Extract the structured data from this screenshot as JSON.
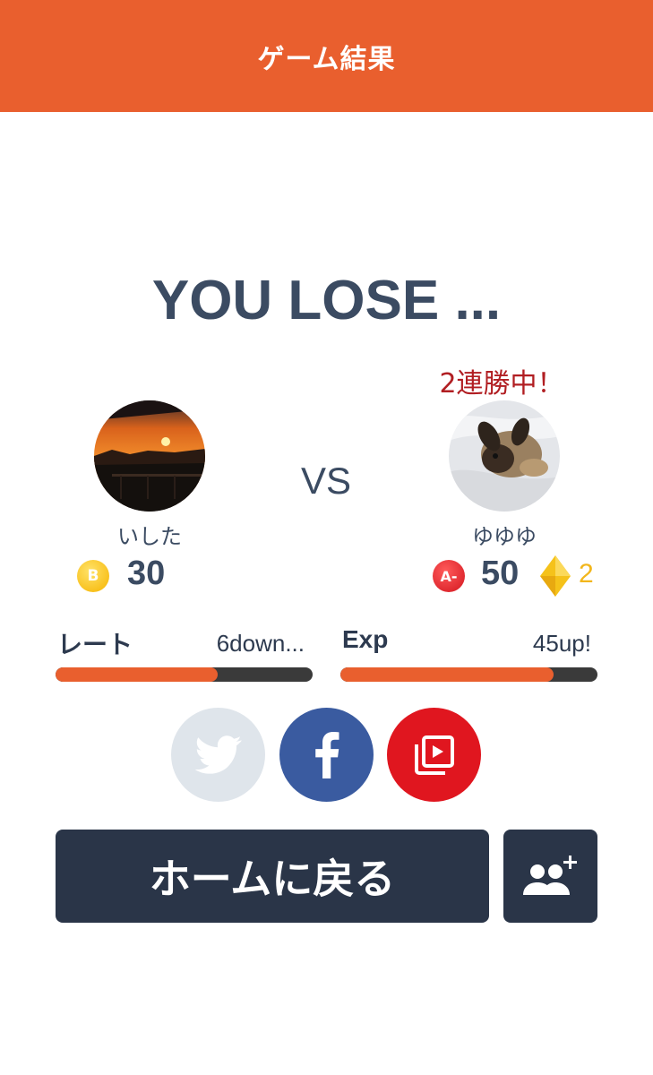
{
  "header": {
    "title": "ゲーム結果"
  },
  "result": {
    "text": "YOU LOSE ..."
  },
  "opponent_streak": "2連勝中！",
  "vs_label": "VS",
  "player": {
    "name": "いした",
    "rank_badge": "B",
    "score": "30"
  },
  "opponent": {
    "name": "ゆゆゆ",
    "rank_badge": "A-",
    "score": "50",
    "diamonds": "2"
  },
  "stats": {
    "rate": {
      "label": "レート",
      "value": "6down...",
      "progress": 0.63
    },
    "exp": {
      "label": "Exp",
      "value": "45up!",
      "progress": 0.83
    }
  },
  "share": {
    "buttons": [
      {
        "icon": "twitter-icon",
        "color": "#dfe5eb"
      },
      {
        "icon": "facebook-icon",
        "color": "#3a5ba0"
      },
      {
        "icon": "video-icon",
        "color": "#e0161f"
      }
    ]
  },
  "actions": {
    "home_label": "ホームに戻る",
    "add_friend_icon": "add-friend-icon"
  },
  "colors": {
    "accent": "#e95f2e",
    "text": "#3b4b62",
    "dark_button": "#2a3548",
    "streak": "#b11e22"
  }
}
